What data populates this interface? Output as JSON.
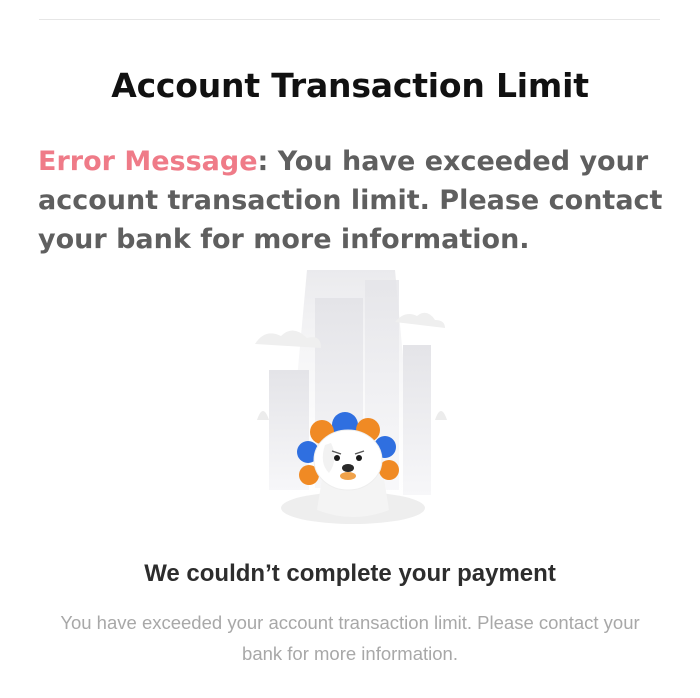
{
  "page": {
    "title": "Account Transaction Limit",
    "error_label": "Error Message",
    "error_separator": ": ",
    "error_text": "You have exceeded your account transaction limit. Please contact your bank for more information."
  },
  "screenshot": {
    "headline": "We couldn’t complete your payment",
    "body": "You have exceeded your account transaction limit. Please contact your bank for more information."
  },
  "colors": {
    "error_label": "#ef7b88",
    "body_text": "#5f5f5f",
    "headline_text": "#2d2d2d",
    "muted_text": "#a8a8a8",
    "mascot_blue": "#2f6fe0",
    "mascot_orange": "#f08a24"
  },
  "icons": {
    "illustration": "dog-mascot-illustration"
  }
}
